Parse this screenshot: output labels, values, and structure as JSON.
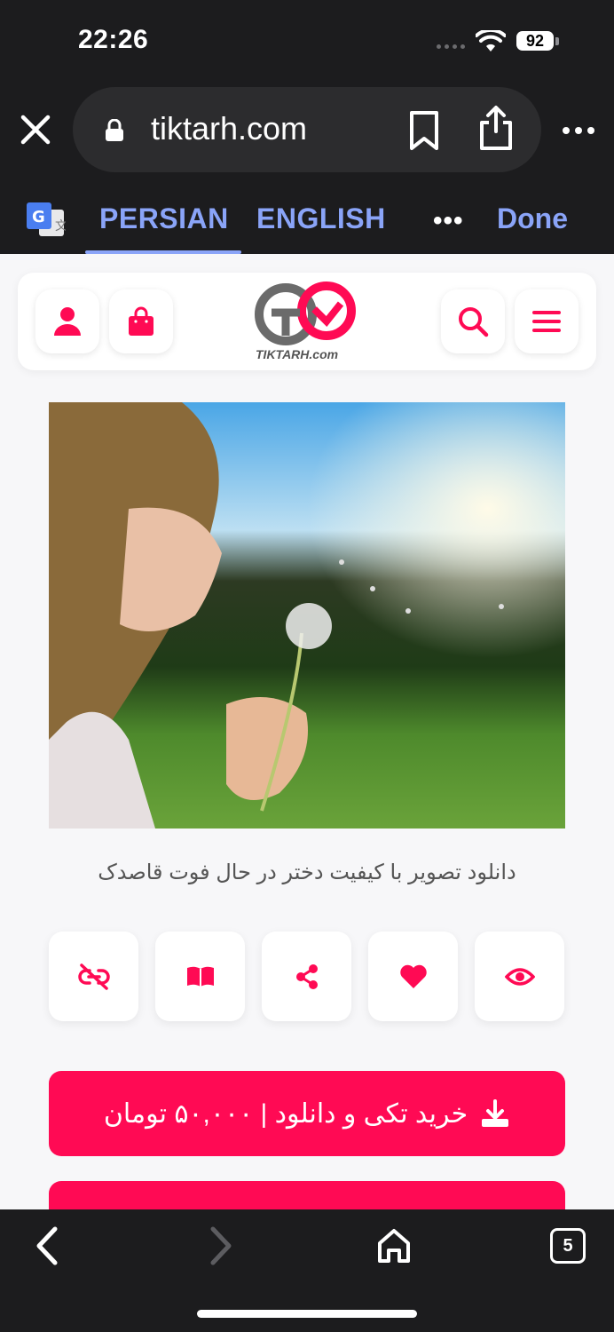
{
  "status_bar": {
    "time": "22:26",
    "battery": "92"
  },
  "browser": {
    "url": "tiktarh.com",
    "icons": {
      "close": "close-icon",
      "lock": "lock-icon",
      "bookmark": "bookmark-icon",
      "share": "share-icon",
      "more": "more-icon"
    }
  },
  "translate_bar": {
    "tabs": [
      "PERSIAN",
      "ENGLISH"
    ],
    "selected": "PERSIAN",
    "more_label": "•••",
    "done_label": "Done"
  },
  "site_header": {
    "logo_text": "TIKTARH.com",
    "icons": {
      "user": "user-icon",
      "bag": "shopping-bag-icon",
      "search": "search-icon",
      "menu": "menu-icon"
    }
  },
  "product": {
    "caption": "دانلود تصویر با کیفیت دختر در حال فوت قاصدک"
  },
  "actions": [
    "unlink-icon",
    "book-icon",
    "share-nodes-icon",
    "heart-icon",
    "eye-icon"
  ],
  "buy_button": {
    "label": "خرید تکی و دانلود | ۵۰,۰۰۰ تومان",
    "icon": "download-icon"
  },
  "bottom_bar": {
    "tab_count": "5"
  },
  "colors": {
    "accent": "#ff0a54",
    "translate_blue": "#8aa4f8",
    "chrome_dark": "#1c1c1e"
  }
}
